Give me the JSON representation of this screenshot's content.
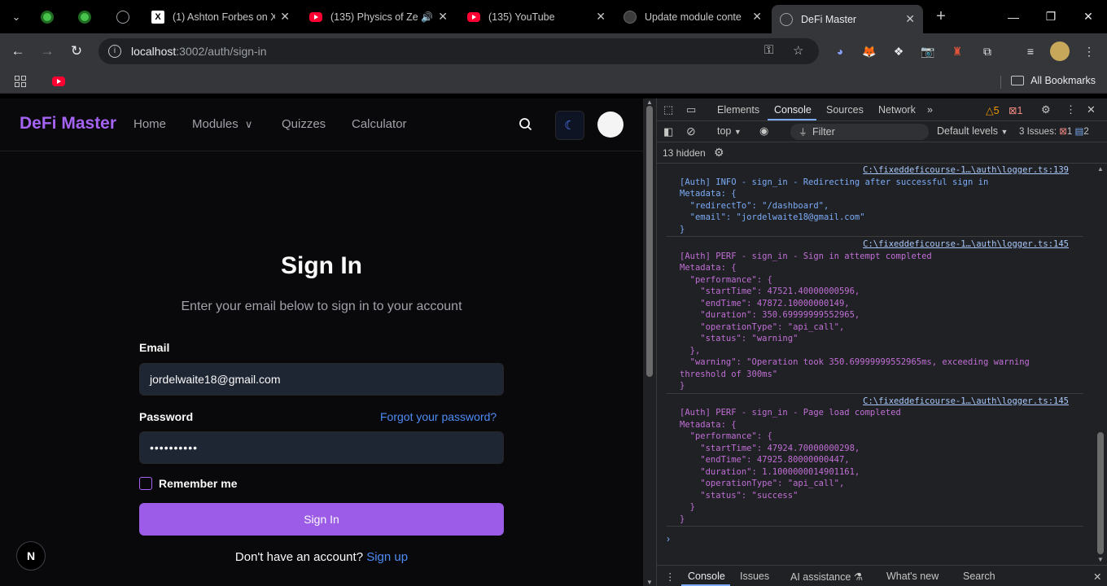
{
  "browser": {
    "tabs": [
      {
        "title": "",
        "icon": "green-app-icon"
      },
      {
        "title": "",
        "icon": "green-app-icon"
      },
      {
        "title": "",
        "icon": "globe-icon"
      },
      {
        "title": "(1) Ashton Forbes on X",
        "icon": "x-icon"
      },
      {
        "title": "(135) Physics of Ze",
        "icon": "youtube-icon"
      },
      {
        "title": "(135) YouTube",
        "icon": "youtube-icon"
      },
      {
        "title": "Update module conte",
        "icon": "github-icon"
      },
      {
        "title": "DeFi Master",
        "icon": "globe-icon"
      }
    ],
    "new_tab": "+",
    "url_host": "localhost",
    "url_path": ":3002/auth/sign-in",
    "bookmarks_all": "All Bookmarks"
  },
  "site": {
    "brand": "DeFi Master",
    "nav": [
      "Home",
      "Modules",
      "Quizzes",
      "Calculator"
    ],
    "chevron": "⌄",
    "signin_title": "Sign In",
    "signin_subtitle": "Enter your email below to sign in to your account",
    "email_label": "Email",
    "email_value": "jordelwaite18@gmail.com",
    "password_label": "Password",
    "password_value": "••••••••••",
    "forgot": "Forgot your password?",
    "remember": "Remember me",
    "signin_button": "Sign In",
    "signup_prompt": "Don't have an account?",
    "signup_link": "Sign up",
    "next_badge": "N"
  },
  "devtools": {
    "tabs": [
      "Elements",
      "Console",
      "Sources",
      "Network"
    ],
    "more": "»",
    "warn_count": "5",
    "error_count": "1",
    "context": "top",
    "filter_placeholder": "Filter",
    "levels": "Default levels",
    "issues_label": "3 Issues:",
    "issues_error": "1",
    "issues_info": "2",
    "hidden": "13 hidden",
    "messages": [
      {
        "source": "C:\\fixeddeficourse-1…\\auth\\logger.ts:139",
        "kind": "info",
        "lines": [
          "[Auth] INFO - sign_in - Redirecting after successful sign in",
          "Metadata: {",
          "  \"redirectTo\": \"/dashboard\",",
          "  \"email\": \"jordelwaite18@gmail.com\"",
          "}"
        ]
      },
      {
        "source": "C:\\fixeddeficourse-1…\\auth\\logger.ts:145",
        "kind": "perf",
        "lines": [
          "[Auth] PERF - sign_in - Sign in attempt completed",
          "Metadata: {",
          "  \"performance\": {",
          "    \"startTime\": 47521.40000000596,",
          "    \"endTime\": 47872.10000000149,",
          "    \"duration\": 350.69999999552965,",
          "    \"operationType\": \"api_call\",",
          "    \"status\": \"warning\"",
          "  },",
          "  \"warning\": \"Operation took 350.69999999552965ms, exceeding warning",
          "threshold of 300ms\"",
          "}"
        ]
      },
      {
        "source": "C:\\fixeddeficourse-1…\\auth\\logger.ts:145",
        "kind": "perf",
        "lines": [
          "[Auth] PERF - sign_in - Page load completed",
          "Metadata: {",
          "  \"performance\": {",
          "    \"startTime\": 47924.70000000298,",
          "    \"endTime\": 47925.80000000447,",
          "    \"duration\": 1.1000000014901161,",
          "    \"operationType\": \"api_call\",",
          "    \"status\": \"success\"",
          "  }",
          "}"
        ]
      }
    ],
    "prompt": "›",
    "drawer_tabs": [
      "Console",
      "Issues",
      "AI assistance",
      "What's new",
      "Search"
    ]
  }
}
